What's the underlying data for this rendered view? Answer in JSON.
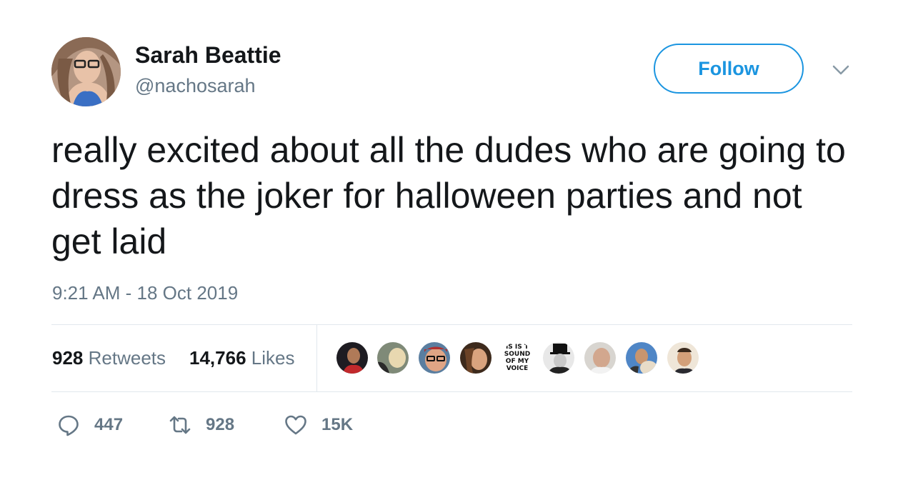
{
  "author": {
    "name": "Sarah Beattie",
    "handle": "@nachosarah"
  },
  "follow_button": {
    "label": "Follow"
  },
  "menu": {
    "icon": "chevron-down-icon"
  },
  "tweet": {
    "text": "really excited about all the dudes who are going to dress as the joker for halloween parties and not get laid",
    "timestamp": "9:21 AM - 18 Oct 2019"
  },
  "stats": {
    "retweets": {
      "count": "928",
      "label": "Retweets"
    },
    "likes": {
      "count": "14,766",
      "label": "Likes"
    }
  },
  "liker_avatar_text": [
    "IS IS T",
    "SOUND",
    "OF MY",
    "VOICE"
  ],
  "actions": {
    "reply": {
      "icon": "reply-icon",
      "count": "447"
    },
    "retweet": {
      "icon": "retweet-icon",
      "count": "928"
    },
    "like": {
      "icon": "heart-icon",
      "count": "15K"
    }
  },
  "colors": {
    "accent": "#1b95e0",
    "text_primary": "#14171a",
    "text_secondary": "#657786",
    "divider": "#e1e8ed"
  }
}
